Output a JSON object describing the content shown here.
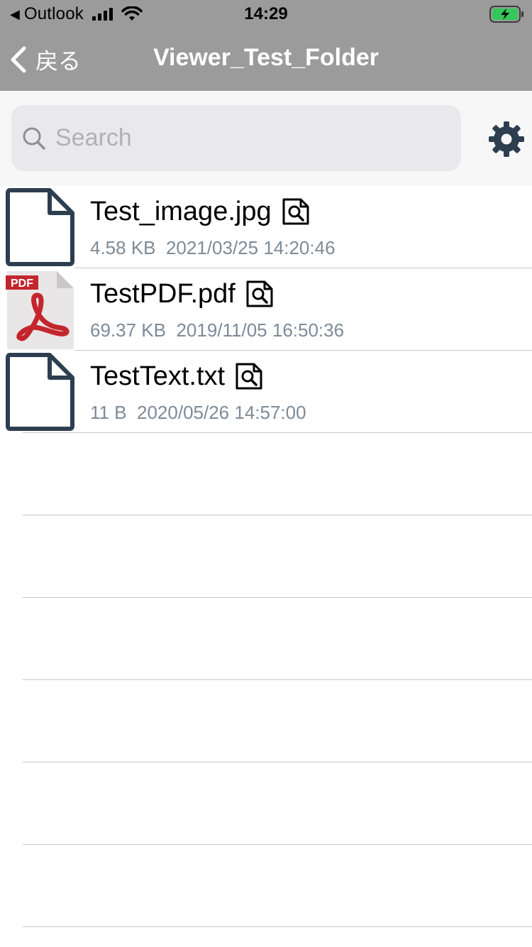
{
  "status_bar": {
    "back_app": "Outlook",
    "time": "14:29",
    "battery_color": "#34c759"
  },
  "nav": {
    "back_label": "戻る",
    "title": "Viewer_Test_Folder"
  },
  "search": {
    "placeholder": "Search"
  },
  "files": [
    {
      "name": "Test_image.jpg",
      "size": "4.58 KB",
      "date": "2021/03/25 14:20:46",
      "icon": "document-icon"
    },
    {
      "name": "TestPDF.pdf",
      "size": "69.37 KB",
      "date": "2019/11/05 16:50:36",
      "icon": "pdf-icon",
      "badge": "PDF"
    },
    {
      "name": "TestText.txt",
      "size": "11 B",
      "date": "2020/05/26 14:57:00",
      "icon": "document-icon"
    }
  ],
  "colors": {
    "nav_background": "#9b9b9b",
    "icon_stroke": "#2c3e50",
    "meta_text": "#7d8b99",
    "pdf_red": "#c4262e"
  }
}
